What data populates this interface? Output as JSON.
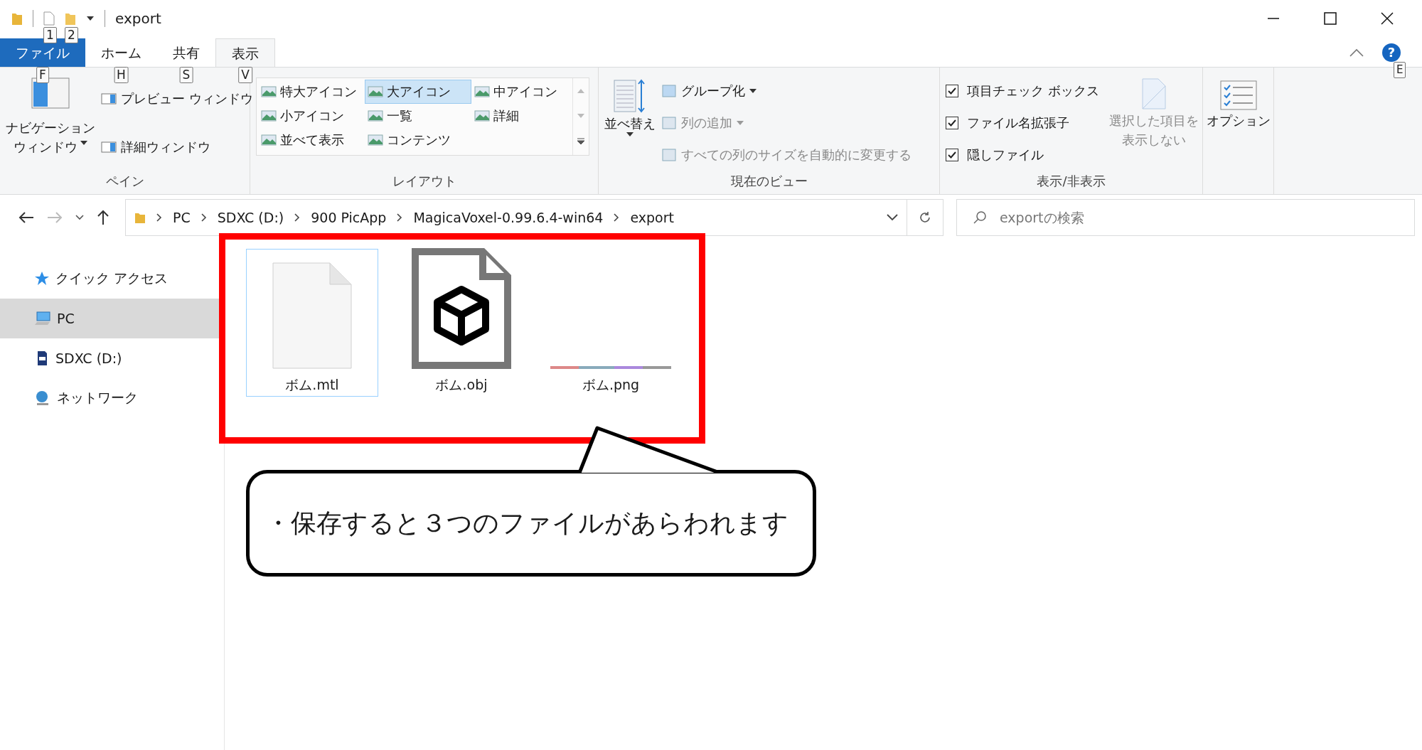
{
  "window": {
    "title": "export"
  },
  "quick_access": {
    "keytips": [
      "1",
      "2"
    ]
  },
  "tabs": [
    {
      "label": "ファイル",
      "kind": "file",
      "selected": false,
      "keytip": "F"
    },
    {
      "label": "ホーム",
      "kind": "tab",
      "selected": false,
      "keytip": "H"
    },
    {
      "label": "共有",
      "kind": "tab",
      "selected": false,
      "keytip": "S"
    },
    {
      "label": "表示",
      "kind": "tab",
      "selected": true,
      "keytip": "V"
    }
  ],
  "help": {
    "label": "?",
    "keytip": "E"
  },
  "ribbon": {
    "pane": {
      "nav_button": [
        "ナビゲーション",
        "ウィンドウ"
      ],
      "items": [
        "プレビュー ウィンドウ",
        "詳細ウィンドウ"
      ],
      "label": "ペイン"
    },
    "layout": {
      "items": [
        {
          "label": "特大アイコン",
          "selected": false
        },
        {
          "label": "大アイコン",
          "selected": true
        },
        {
          "label": "中アイコン",
          "selected": false
        },
        {
          "label": "小アイコン",
          "selected": false
        },
        {
          "label": "一覧",
          "selected": false
        },
        {
          "label": "詳細",
          "selected": false
        },
        {
          "label": "並べて表示",
          "selected": false
        },
        {
          "label": "コンテンツ",
          "selected": false
        }
      ],
      "label": "レイアウト"
    },
    "current_view": {
      "sort_button": "並べ替え",
      "items": [
        {
          "label": "グループ化",
          "disabled": false,
          "dropdown": true
        },
        {
          "label": "列の追加",
          "disabled": true,
          "dropdown": true
        },
        {
          "label": "すべての列のサイズを自動的に変更する",
          "disabled": true,
          "dropdown": false
        }
      ],
      "label": "現在のビュー"
    },
    "show_hide": {
      "checkboxes": [
        {
          "label": "項目チェック ボックス",
          "checked": true
        },
        {
          "label": "ファイル名拡張子",
          "checked": true
        },
        {
          "label": "隠しファイル",
          "checked": true
        }
      ],
      "hide_selected": {
        "lines": [
          "選択した項目を",
          "表示しない"
        ],
        "disabled": true
      },
      "label": "表示/非表示"
    },
    "options": {
      "label": "オプション"
    }
  },
  "address": {
    "crumbs": [
      "PC",
      "SDXC (D:)",
      "900 PicApp",
      "MagicaVoxel-0.99.6.4-win64",
      "export"
    ]
  },
  "search": {
    "placeholder": "exportの検索"
  },
  "sidebar": {
    "items": [
      {
        "label": "クイック アクセス",
        "kind": "quick",
        "selected": false
      },
      {
        "label": "PC",
        "kind": "pc",
        "selected": true
      },
      {
        "label": "SDXC (D:)",
        "kind": "sd",
        "selected": false
      },
      {
        "label": "ネットワーク",
        "kind": "network",
        "selected": false
      }
    ]
  },
  "files": [
    {
      "name": "ボム.mtl",
      "kind": "blank",
      "selected": true
    },
    {
      "name": "ボム.obj",
      "kind": "model",
      "selected": false
    },
    {
      "name": "ボム.png",
      "kind": "image",
      "selected": false
    }
  ],
  "callout": {
    "text": "・保存すると３つのファイルがあらわれます"
  }
}
